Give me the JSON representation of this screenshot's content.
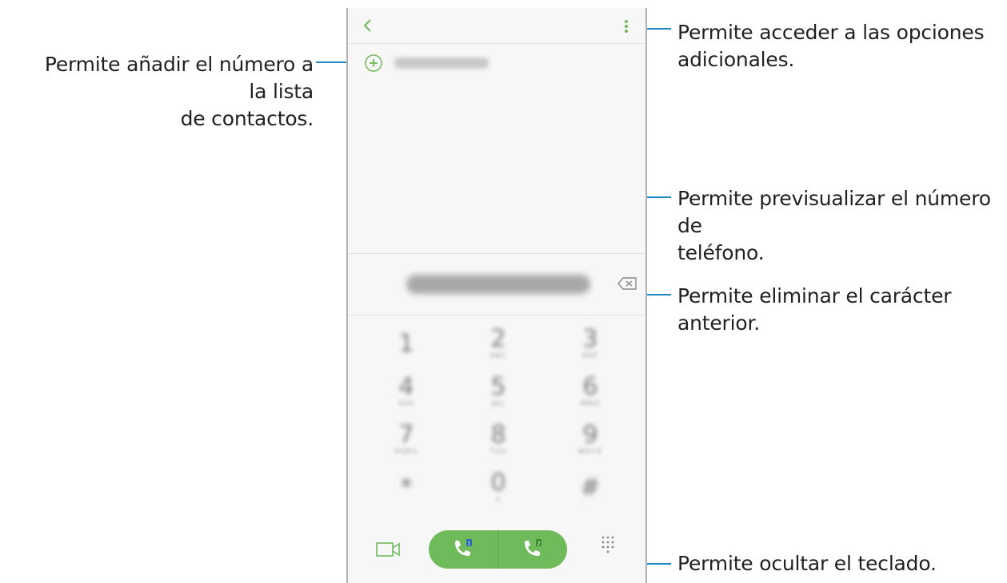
{
  "annotations": {
    "add_contact": "Permite añadir el número a la lista de contactos.",
    "add_contact_line1": "Permite añadir el número a la lista",
    "add_contact_line2": "de contactos.",
    "more_options_line1": "Permite acceder a las opciones",
    "more_options_line2": "adicionales.",
    "preview_line1": "Permite previsualizar el número de",
    "preview_line2": "teléfono.",
    "delete_line1": "Permite eliminar el carácter",
    "delete_line2": "anterior.",
    "hide_keypad": "Permite ocultar el teclado."
  },
  "colors": {
    "accent_green": "#6fba5a",
    "leader_blue": "#1c86c6"
  },
  "icons": {
    "back": "chevron-left-icon",
    "more": "more-vertical-icon",
    "add": "plus-circle-icon",
    "backspace": "backspace-icon",
    "video": "video-call-icon",
    "call_sim1": "phone-sim1-icon",
    "call_sim2": "phone-sim2-icon",
    "keypad": "dialpad-icon"
  },
  "keypad": {
    "keys": [
      {
        "digit": "1",
        "letters": ""
      },
      {
        "digit": "2",
        "letters": "ABC"
      },
      {
        "digit": "3",
        "letters": "DEF"
      },
      {
        "digit": "4",
        "letters": "GHI"
      },
      {
        "digit": "5",
        "letters": "JKL"
      },
      {
        "digit": "6",
        "letters": "MNO"
      },
      {
        "digit": "7",
        "letters": "PQRS"
      },
      {
        "digit": "8",
        "letters": "TUV"
      },
      {
        "digit": "9",
        "letters": "WXYZ"
      },
      {
        "digit": "*",
        "letters": ""
      },
      {
        "digit": "0",
        "letters": "+"
      },
      {
        "digit": "#",
        "letters": ""
      }
    ]
  }
}
